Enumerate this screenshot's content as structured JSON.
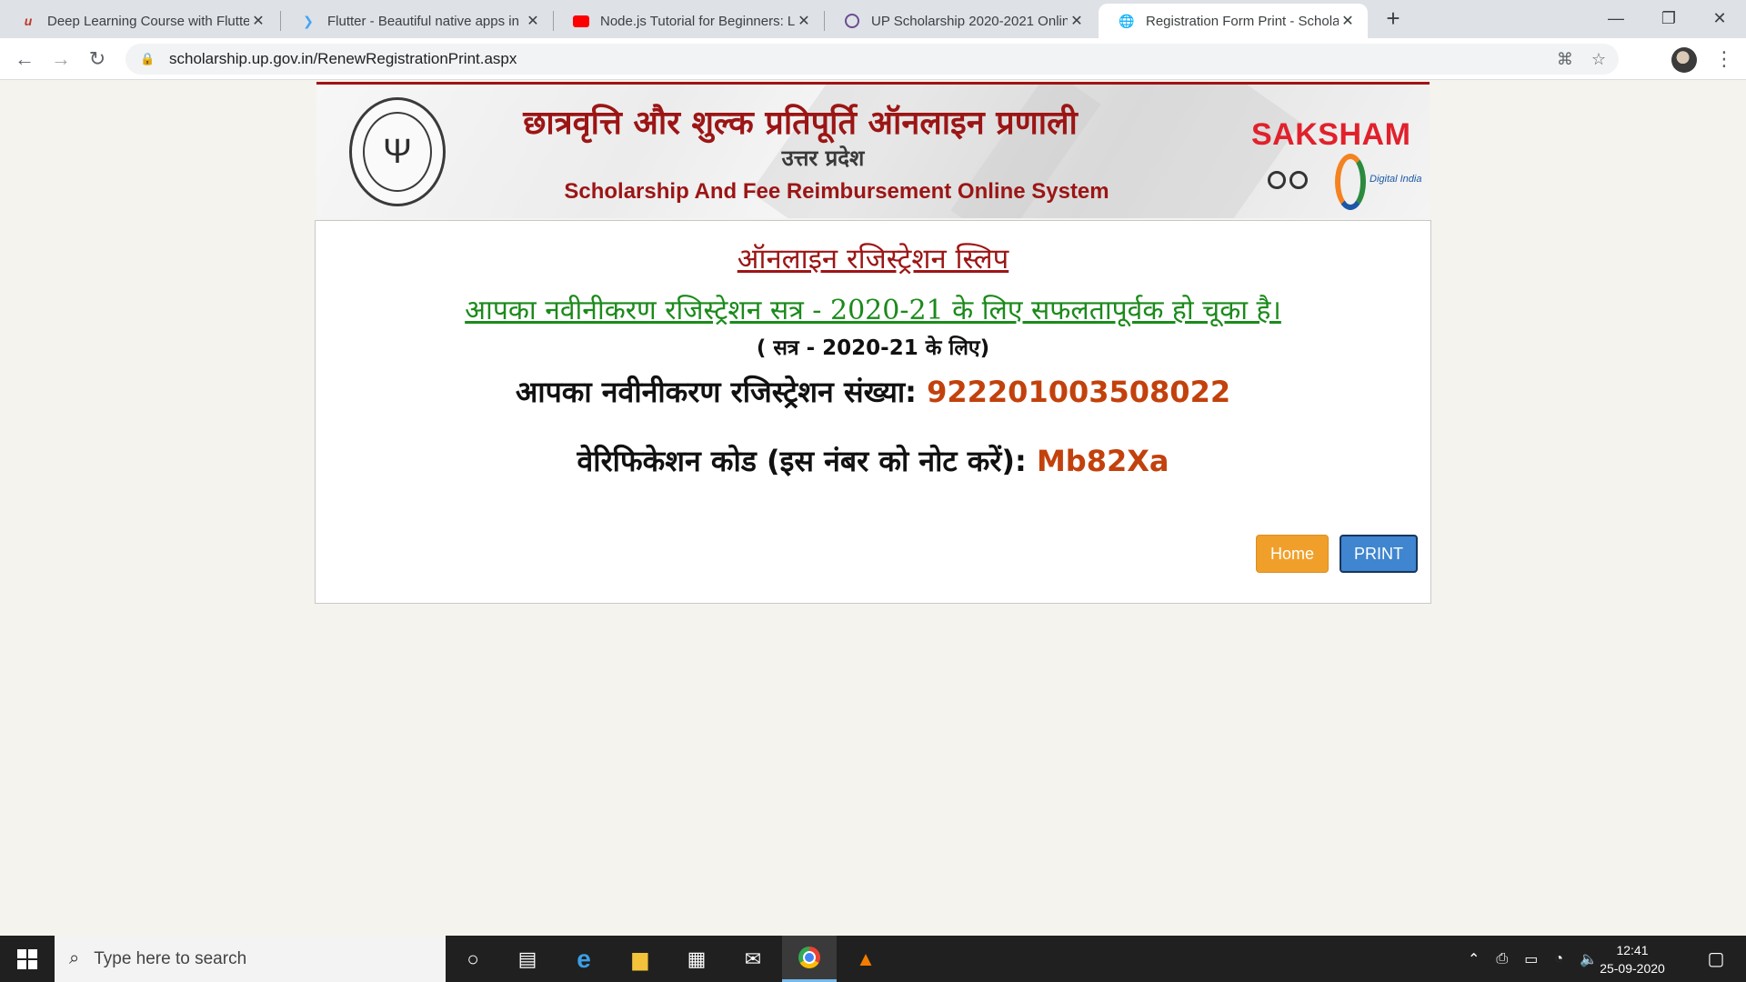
{
  "browser": {
    "tabs": [
      {
        "title": "Deep Learning Course with Flutter",
        "icon": "udemy-icon"
      },
      {
        "title": "Flutter - Beautiful native apps in r",
        "icon": "flutter-icon"
      },
      {
        "title": "Node.js Tutorial for Beginners: Le",
        "icon": "youtube-icon"
      },
      {
        "title": "UP Scholarship 2020-2021 Online",
        "icon": "site-icon"
      },
      {
        "title": "Registration Form Print - Scholars",
        "icon": "globe-icon",
        "active": true
      }
    ],
    "url": "scholarship.up.gov.in/RenewRegistrationPrint.aspx"
  },
  "header": {
    "title_hi": "छात्रवृत्ति और शुल्क प्रतिपूर्ति ऑनलाइन प्रणाली",
    "state_hi": "उत्तर प्रदेश",
    "title_en": "Scholarship And Fee Reimbursement Online System",
    "saksham": "SAKSHAM",
    "digital_india": "Digital India"
  },
  "slip": {
    "heading": "ऑनलाइन रजिस्ट्रेशन स्लिप",
    "success_msg": "आपका नवीनीकरण रजिस्ट्रेशन सत्र - 2020-21 के लिए सफलतापूर्वक हो चूका है।",
    "session": "( सत्र - 2020-21 के लिए)",
    "reg_label": "आपका नवीनीकरण रजिस्ट्रेशन संख्या:",
    "reg_number": "922201003508022",
    "verify_label": "वेरिफिकेशन कोड (इस नंबर को नोट करें):",
    "verify_code": "Mb82Xa",
    "home_label": "Home",
    "print_label": "PRINT"
  },
  "taskbar": {
    "search_placeholder": "Type here to search",
    "time": "12:41",
    "date": "25-09-2020"
  },
  "colors": {
    "accent_red": "#9c1515",
    "success_green": "#1b8a1b",
    "value_orange": "#c2410c",
    "home_button": "#f0a02a",
    "print_button": "#3f85cf"
  }
}
